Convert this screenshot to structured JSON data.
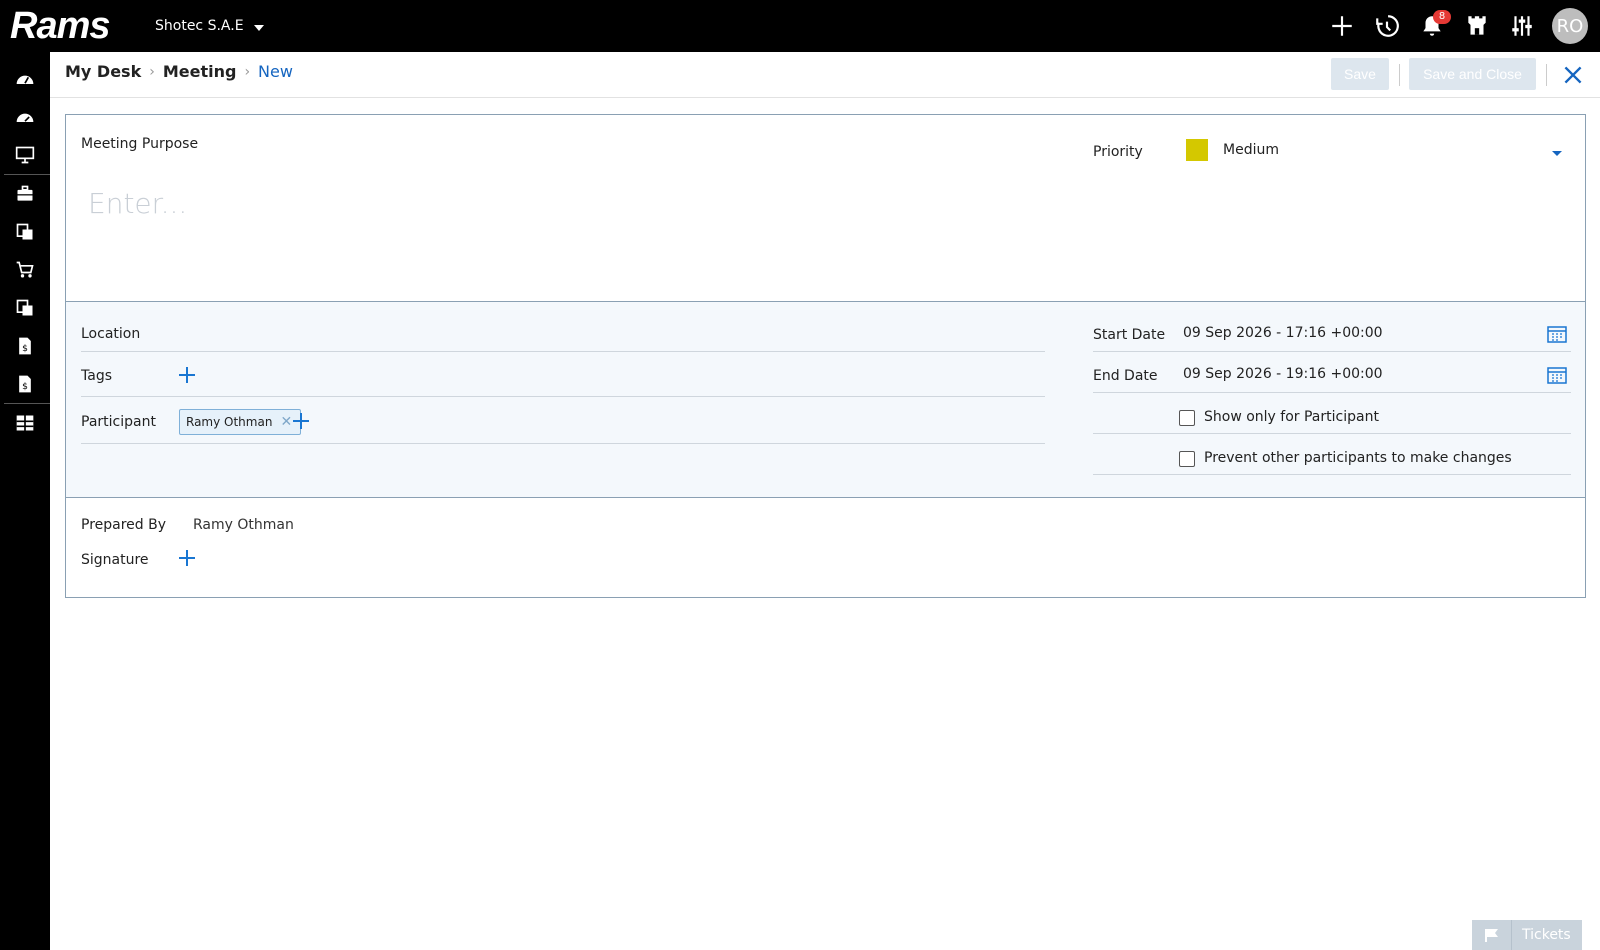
{
  "app": {
    "logo_text": "Rams",
    "company": "Shotec S.A.E",
    "notification_count": "8",
    "user_initials": "RO"
  },
  "sidebar": {
    "items": [
      {
        "icon": "dashboard-icon"
      },
      {
        "icon": "dashboard-alt-icon"
      },
      {
        "icon": "monitor-icon"
      },
      {
        "icon": "briefcase-icon"
      },
      {
        "icon": "documents-icon"
      },
      {
        "icon": "cart-icon"
      },
      {
        "icon": "documents-alt-icon"
      },
      {
        "icon": "invoice-icon"
      },
      {
        "icon": "invoice-alt-icon"
      },
      {
        "icon": "reports-icon"
      }
    ]
  },
  "header": {
    "breadcrumb": [
      "My Desk",
      "Meeting",
      "New"
    ],
    "save_label": "Save",
    "save_close_label": "Save and Close"
  },
  "form": {
    "purpose_label": "Meeting Purpose",
    "purpose_placeholder": "Enter...",
    "priority_label": "Priority",
    "priority_value": "Medium",
    "priority_color": "#d4c800",
    "location_label": "Location",
    "tags_label": "Tags",
    "participant_label": "Participant",
    "participants": [
      "Ramy Othman"
    ],
    "start_date_label": "Start Date",
    "start_date_value": "09 Sep 2026 - 17:16 +00:00",
    "end_date_label": "End Date",
    "end_date_value": "09 Sep 2026 - 19:16 +00:00",
    "show_only_label": "Show only for Participant",
    "prevent_label": "Prevent other participants to make changes",
    "prepared_by_label": "Prepared By",
    "prepared_by_value": "Ramy Othman",
    "signature_label": "Signature"
  },
  "footer": {
    "tickets_label": "Tickets"
  }
}
